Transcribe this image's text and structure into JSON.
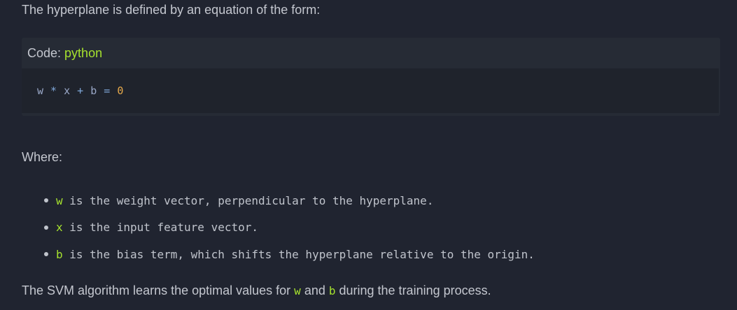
{
  "intro_text": "The hyperplane is defined by an equation of the form:",
  "code_block": {
    "label": "Code:",
    "language": "python",
    "tokens": [
      {
        "text": "w",
        "kind": "var"
      },
      {
        "text": " * ",
        "kind": "op"
      },
      {
        "text": "x",
        "kind": "var"
      },
      {
        "text": " + ",
        "kind": "op"
      },
      {
        "text": "b",
        "kind": "var"
      },
      {
        "text": " = ",
        "kind": "op"
      },
      {
        "text": "0",
        "kind": "num"
      }
    ]
  },
  "where_label": "Where:",
  "bullets": [
    {
      "term": "w",
      "rest": " is the weight vector, perpendicular to the hyperplane."
    },
    {
      "term": "x",
      "rest": " is the input feature vector."
    },
    {
      "term": "b",
      "rest": " is the bias term, which shifts the hyperplane relative to the origin."
    }
  ],
  "outro": {
    "before": "The SVM algorithm learns the optimal values for ",
    "term1": "w",
    "middle": " and ",
    "term2": "b",
    "after": " during the training process."
  },
  "colors": {
    "background": "#202430",
    "highlight": "#a6e22e",
    "number": "#e6a94b"
  }
}
